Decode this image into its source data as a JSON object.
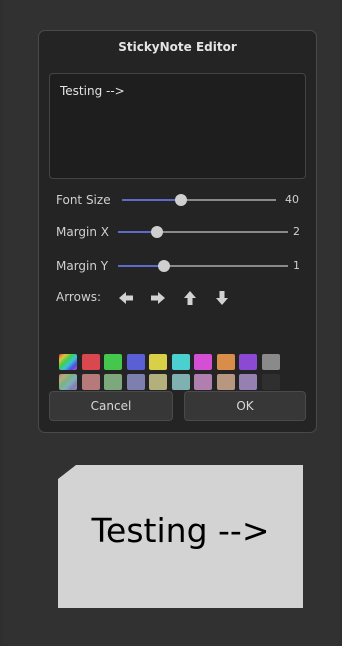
{
  "dialog": {
    "title": "StickyNote Editor",
    "text_value": "Testing -->"
  },
  "sliders": [
    {
      "label": "Font Size",
      "value": "40",
      "fraction": 0.38
    },
    {
      "label": "Margin X",
      "value": "2",
      "fraction": 0.23
    },
    {
      "label": "Margin Y",
      "value": "1",
      "fraction": 0.27
    }
  ],
  "arrows": {
    "label": "Arrows:",
    "buttons": [
      "arrow-left-icon",
      "arrow-right-icon",
      "arrow-up-icon",
      "arrow-down-icon"
    ]
  },
  "colors": {
    "row1": [
      "rainbow",
      "#d9484f",
      "#45c64c",
      "#5a5fd3",
      "#d9d048",
      "#4bcfcf",
      "#d44fd3",
      "#d98d4a",
      "#8c49d4",
      "#8a8a8a"
    ],
    "row2": [
      "rainbow-muted",
      "#b77a7b",
      "#7da87e",
      "#7d7faf",
      "#b3b07e",
      "#7fb1b1",
      "#b07fb0",
      "#b79780",
      "#9680b1",
      "#2f2f2f"
    ]
  },
  "buttons": {
    "cancel": "Cancel",
    "ok": "OK"
  },
  "preview": {
    "text": "Testing -->",
    "paper_color": "#d3d3d3"
  }
}
